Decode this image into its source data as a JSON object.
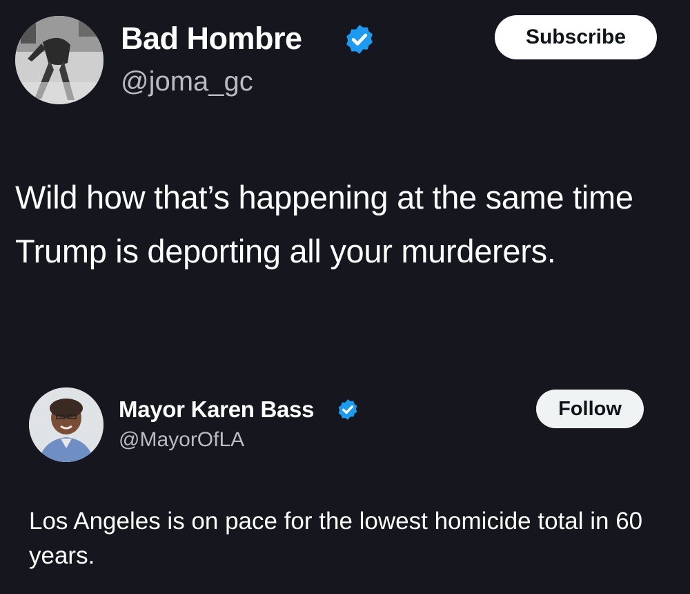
{
  "main_post": {
    "author_name": "Bad Hombre",
    "handle": "@joma_gc",
    "verified": true,
    "subscribe_label": "Subscribe",
    "text": "Wild how that’s happening at the same time Trump is deporting all your murderers."
  },
  "quoted_post": {
    "author_name": "Mayor Karen Bass",
    "handle": "@MayorOfLA",
    "verified": true,
    "follow_label": "Follow",
    "text": "Los Angeles is on pace for the lowest homicide total in 60 years."
  },
  "colors": {
    "background": "#15161e",
    "verified_badge": "#1d9bf0",
    "primary_text": "#ffffff",
    "secondary_text": "#b9bcc1"
  },
  "icons": [
    "verified-badge-icon",
    "avatar-photo"
  ]
}
